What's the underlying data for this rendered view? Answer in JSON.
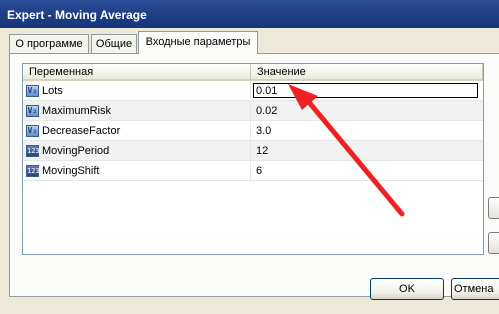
{
  "window": {
    "title": "Expert - Moving Average"
  },
  "tabs": [
    {
      "label": "О программе",
      "active": false
    },
    {
      "label": "Общие",
      "active": false
    },
    {
      "label": "Входные параметры",
      "active": true
    }
  ],
  "grid": {
    "columns": [
      "Переменная",
      "Значение"
    ],
    "rows": [
      {
        "name": "Lots",
        "value": "0.01",
        "type_icon": "double-icon",
        "editing": true
      },
      {
        "name": "MaximumRisk",
        "value": "0.02",
        "type_icon": "double-icon",
        "editing": false
      },
      {
        "name": "DecreaseFactor",
        "value": "3.0",
        "type_icon": "double-icon",
        "editing": false
      },
      {
        "name": "MovingPeriod",
        "value": "12",
        "type_icon": "integer-icon",
        "editing": false
      },
      {
        "name": "MovingShift",
        "value": "6",
        "type_icon": "integer-icon",
        "editing": false
      }
    ]
  },
  "icons": {
    "double_glyph": "V₂",
    "int_glyph": "123"
  },
  "buttons": {
    "ok": "OK",
    "cancel": "Отмена"
  },
  "annotation": {
    "arrow_color": "#ee2222"
  },
  "colors": {
    "titlebar": "#1f3f86",
    "dialog_bg": "#ece9d8",
    "grid_border": "#7f9db9"
  }
}
